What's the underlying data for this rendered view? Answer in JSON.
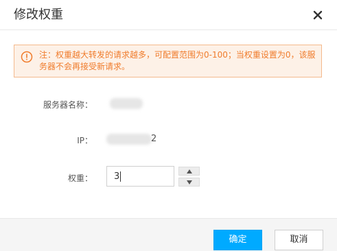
{
  "dialog": {
    "title": "修改权重"
  },
  "notice": {
    "text": "注：权重越大转发的请求越多，可配置范围为0-100；当权重设置为0，该服务器不会再接受新请求。",
    "color": "#f07c2c"
  },
  "form": {
    "server_name_label": "服务器名称：",
    "ip_label": "IP：",
    "ip_visible_suffix": "2",
    "weight_label": "权重：",
    "weight_value": "3"
  },
  "footer": {
    "ok_label": "确定",
    "cancel_label": "取消"
  },
  "colors": {
    "primary": "#00aaff",
    "warning": "#f07c2c"
  },
  "icons": {
    "close": "close-icon",
    "notice": "warning-circle-icon",
    "up": "triangle-up-icon",
    "down": "triangle-down-icon"
  }
}
